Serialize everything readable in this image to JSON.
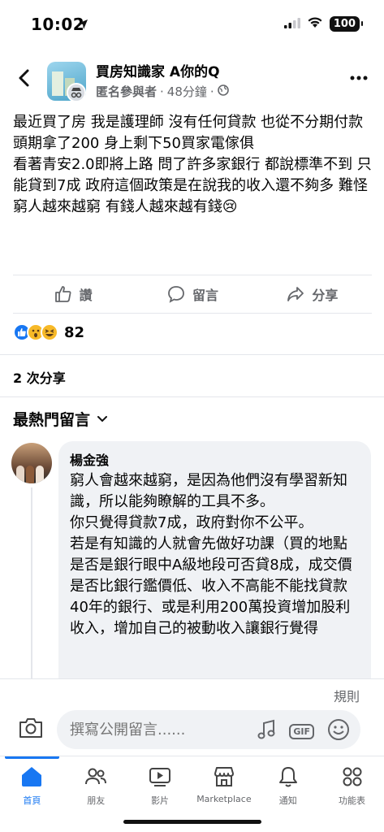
{
  "status_bar": {
    "time": "10:02",
    "battery": "100"
  },
  "post": {
    "group_name": "買房知識家 A你的Q",
    "author": "匿名參與者",
    "time_ago": "48分鐘",
    "body_lines": [
      "最近買了房 我是護理師 沒有任何貸款 也從不分期付款 頭期拿了200 身上剩下50買家電傢俱",
      "看著青安2.0即將上路 問了許多家銀行 都說標準不到 只能貸到7成 政府這個政策是在說我的收入還不夠多 難怪窮人越來越窮 有錢人越來越有錢😢"
    ]
  },
  "actions": {
    "like": "讚",
    "comment": "留言",
    "share": "分享"
  },
  "reactions": {
    "count": "82"
  },
  "share_count": "2 次分享",
  "comment_sort": "最熱門留言",
  "comment": {
    "author": "楊金強",
    "paragraphs": [
      "窮人會越來越窮，是因為他們沒有學習新知識，所以能夠瞭解的工具不多。",
      "你只覺得貸款7成，政府對你不公平。",
      "若是有知識的人就會先做好功課（買的地點是否是銀行眼中A級地段可否貸8成，成交價是否比銀行鑑價低、收入不高能不能找貸款40年的銀行、或是利用200萬投資增加股利收入，增加自己的被動收入讓銀行覺得"
    ]
  },
  "composer": {
    "rules": "規則",
    "placeholder": "撰寫公開留言......"
  },
  "nav": [
    {
      "label": "首頁"
    },
    {
      "label": "朋友"
    },
    {
      "label": "影片"
    },
    {
      "label": "Marketplace"
    },
    {
      "label": "通知"
    },
    {
      "label": "功能表"
    }
  ],
  "colors": {
    "accent": "#1877f2",
    "secondary_text": "#65676b",
    "bubble": "#f0f2f5"
  }
}
